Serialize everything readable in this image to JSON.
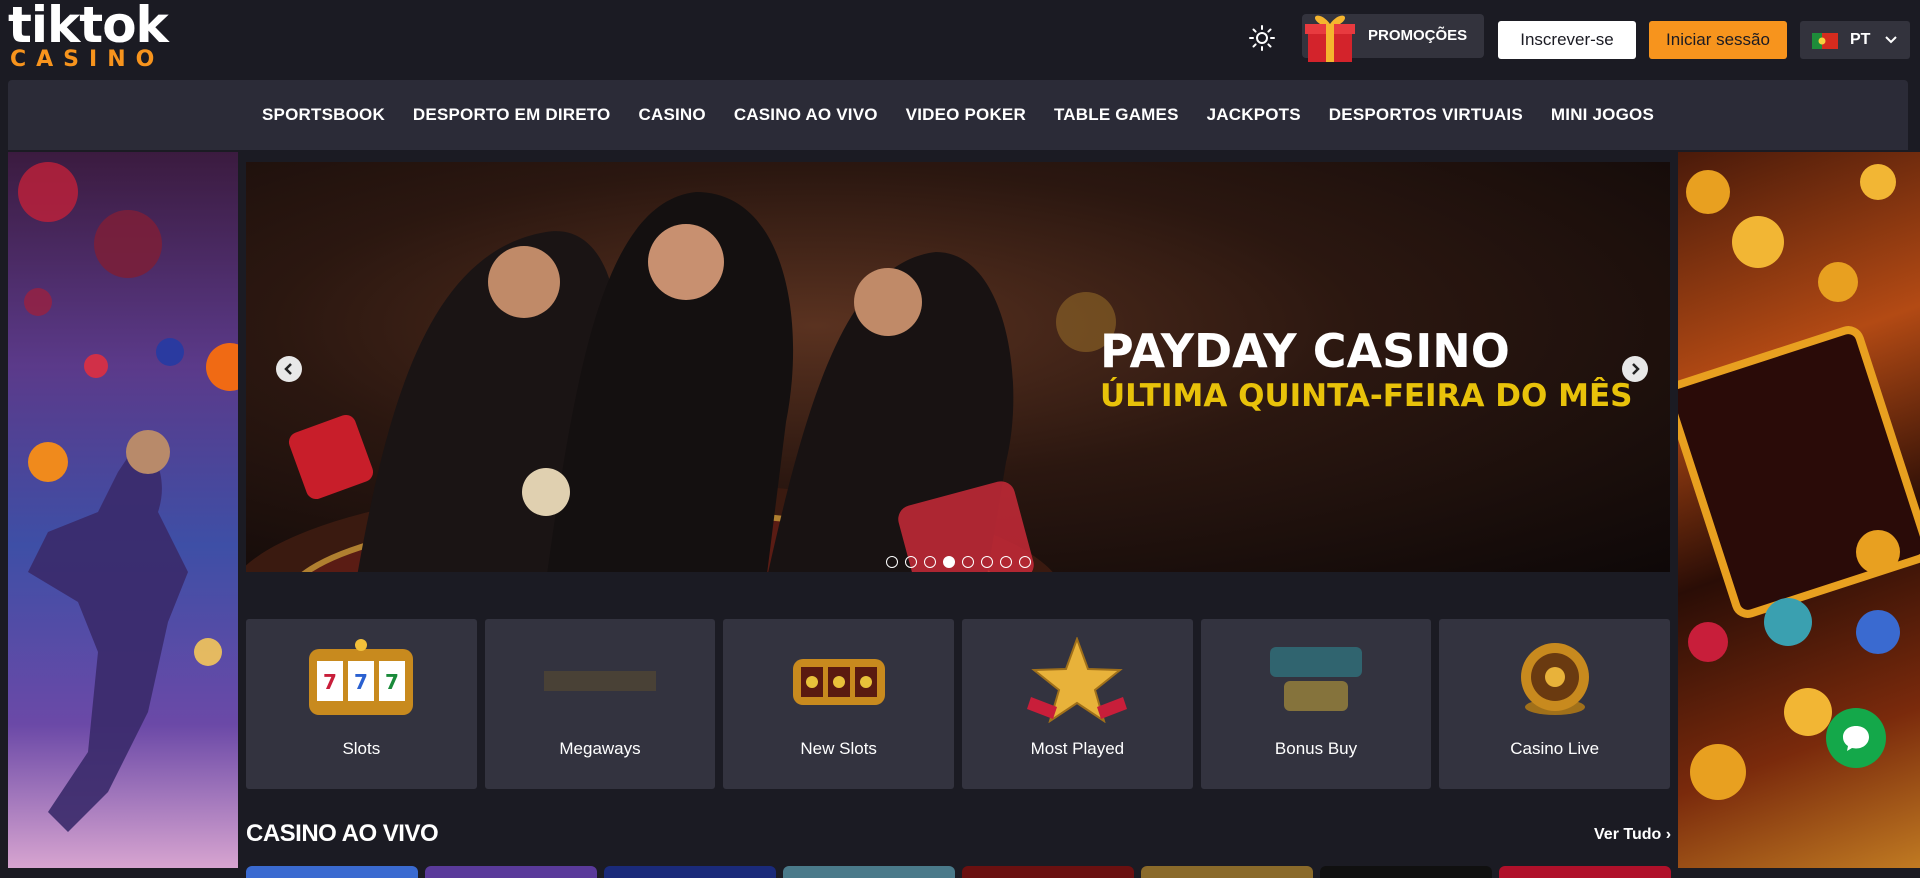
{
  "header": {
    "logo_top": "tiktok",
    "logo_bottom": "CASINO",
    "promo_label": "PROMOÇÕES",
    "signup_label": "Inscrever-se",
    "login_label": "Iniciar sessão",
    "language": "PT"
  },
  "nav": {
    "items": [
      "SPORTSBOOK",
      "DESPORTO EM DIRETO",
      "CASINO",
      "CASINO AO VIVO",
      "VIDEO POKER",
      "TABLE GAMES",
      "JACKPOTS",
      "DESPORTOS VIRTUAIS",
      "MINI JOGOS"
    ]
  },
  "hero": {
    "title": "PAYDAY CASINO",
    "subtitle": "ÚLTIMA QUINTA-FEIRA DO MÊS",
    "slide_count": 8,
    "active_slide": 4
  },
  "categories": [
    {
      "label": "Slots",
      "icon": "slot-machine-icon"
    },
    {
      "label": "Megaways",
      "icon": "megaways-icon"
    },
    {
      "label": "New Slots",
      "icon": "new-slots-icon"
    },
    {
      "label": "Most Played",
      "icon": "star-icon"
    },
    {
      "label": "Bonus Buy",
      "icon": "bonus-buy-icon"
    },
    {
      "label": "Casino Live",
      "icon": "roulette-icon"
    }
  ],
  "section": {
    "title": "CASINO AO VIVO",
    "view_all": "Ver Tudo"
  },
  "colors": {
    "accent": "#f7941d",
    "background": "#1b1b23",
    "nav_bg": "#2b2b37",
    "card_bg": "#33333f",
    "subtitle_yellow": "#e8c20a",
    "chat_green": "#14a84a"
  }
}
